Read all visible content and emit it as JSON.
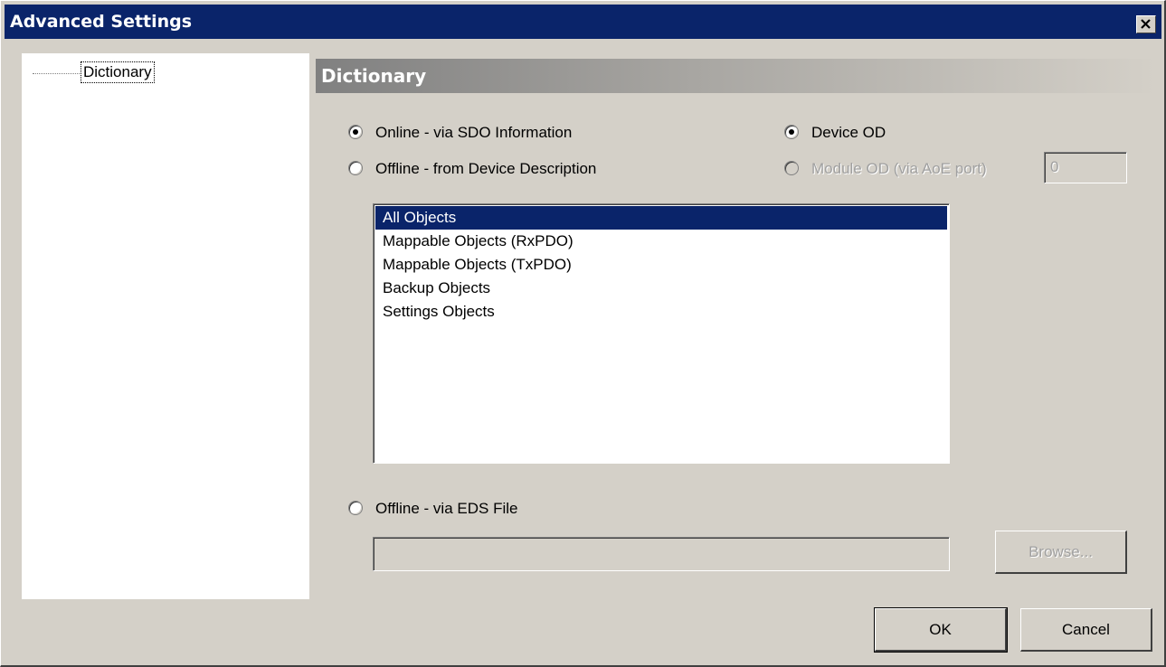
{
  "window": {
    "title": "Advanced Settings",
    "close_icon": "close-x-icon"
  },
  "tree": {
    "items": [
      {
        "label": "Dictionary",
        "selected": true
      }
    ]
  },
  "panel": {
    "header": "Dictionary",
    "source_options": {
      "online_sdo": {
        "label": "Online - via SDO Information",
        "checked": true
      },
      "offline_device_desc": {
        "label": "Offline - from Device Description",
        "checked": false
      },
      "offline_eds": {
        "label": "Offline - via EDS File",
        "checked": false
      }
    },
    "od_options": {
      "device_od": {
        "label": "Device OD",
        "checked": true
      },
      "module_od": {
        "label": "Module OD (via AoE port)",
        "checked": false,
        "disabled": true,
        "port_value": "0"
      }
    },
    "object_list": {
      "items": [
        "All Objects",
        "Mappable Objects (RxPDO)",
        "Mappable Objects (TxPDO)",
        "Backup Objects",
        "Settings Objects"
      ],
      "selected": "All Objects"
    },
    "eds_path": {
      "value": ""
    },
    "browse_button": {
      "label": "Browse...",
      "disabled": true
    }
  },
  "footer": {
    "ok_label": "OK",
    "cancel_label": "Cancel"
  },
  "colors": {
    "face": "#d4d0c8",
    "titlebar": "#0a246a",
    "selection": "#0a246a"
  }
}
